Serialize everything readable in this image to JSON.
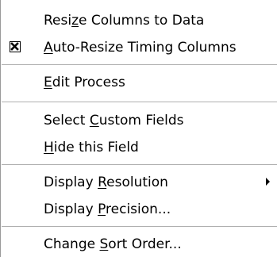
{
  "menu": {
    "items": [
      {
        "pre": "Resi",
        "key": "z",
        "post": "e Columns to Data"
      },
      {
        "pre": "",
        "key": "A",
        "post": "uto-Resize Timing Columns",
        "checked": true
      },
      {
        "pre": "",
        "key": "E",
        "post": "dit Process"
      },
      {
        "pre": "Select ",
        "key": "C",
        "post": "ustom Fields"
      },
      {
        "pre": "",
        "key": "H",
        "post": "ide this Field"
      },
      {
        "pre": "Display ",
        "key": "R",
        "post": "esolution",
        "submenu": true
      },
      {
        "pre": "Display ",
        "key": "P",
        "post": "recision..."
      },
      {
        "pre": "Change ",
        "key": "S",
        "post": "ort Order..."
      }
    ],
    "icons": {
      "check": "checkbox-checked-icon",
      "submenu": "submenu-arrow-icon"
    }
  }
}
